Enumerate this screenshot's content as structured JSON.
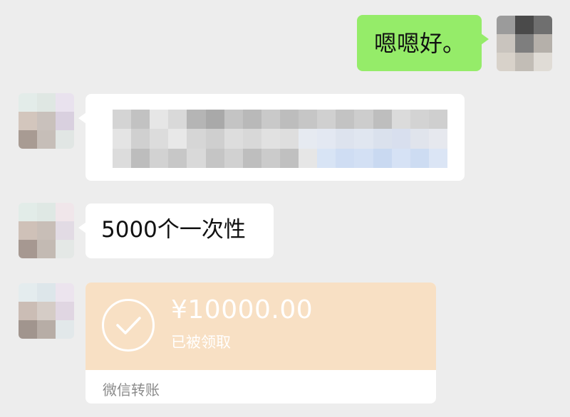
{
  "messages": {
    "outgoing_text": "嗯嗯好。",
    "incoming_text": "5000个一次性"
  },
  "transfer": {
    "amount": "¥10000.00",
    "status": "已被领取",
    "label": "微信转账"
  },
  "colors": {
    "background": "#ededed",
    "outgoing_bubble": "#95ec69",
    "incoming_bubble": "#ffffff",
    "transfer_card": "#f8e0c4",
    "transfer_footer_text": "#8a8a8a"
  },
  "icons": [
    "check-circle-icon"
  ]
}
